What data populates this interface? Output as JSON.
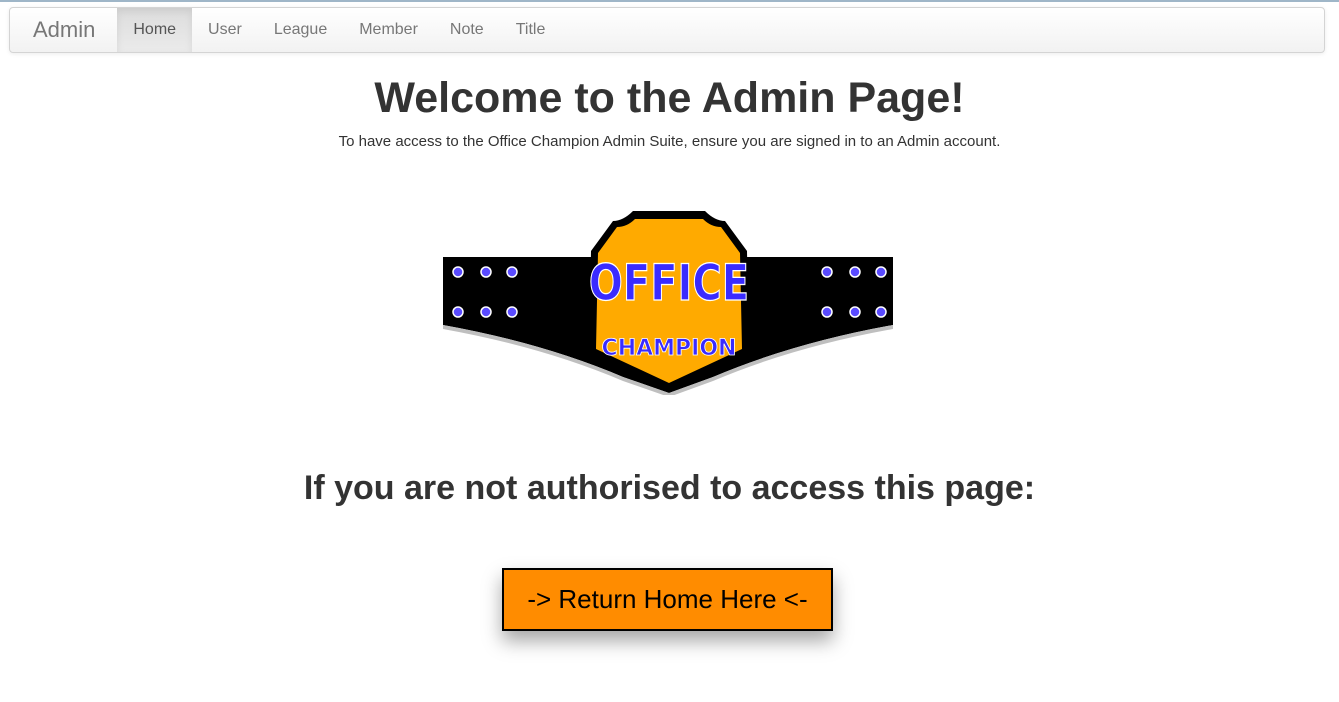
{
  "navbar": {
    "brand": "Admin",
    "items": [
      {
        "label": "Home",
        "active": true
      },
      {
        "label": "User",
        "active": false
      },
      {
        "label": "League",
        "active": false
      },
      {
        "label": "Member",
        "active": false
      },
      {
        "label": "Note",
        "active": false
      },
      {
        "label": "Title",
        "active": false
      }
    ]
  },
  "main": {
    "title": "Welcome to the Admin Page!",
    "subtitle": "To have access to the Office Champion Admin Suite, ensure you are signed in to an Admin account.",
    "logo": {
      "icon": "office-champion-belt-logo",
      "text_top": "OFFICE",
      "text_bottom": "CHAMPION"
    },
    "warning": "If you are not authorised to access this page:",
    "return_button": "-> Return Home Here <-"
  },
  "colors": {
    "button_bg": "#ff8c00",
    "belt_plate": "#ffaa00",
    "belt_text": "#3a2bff",
    "belt_strap": "#000000"
  }
}
